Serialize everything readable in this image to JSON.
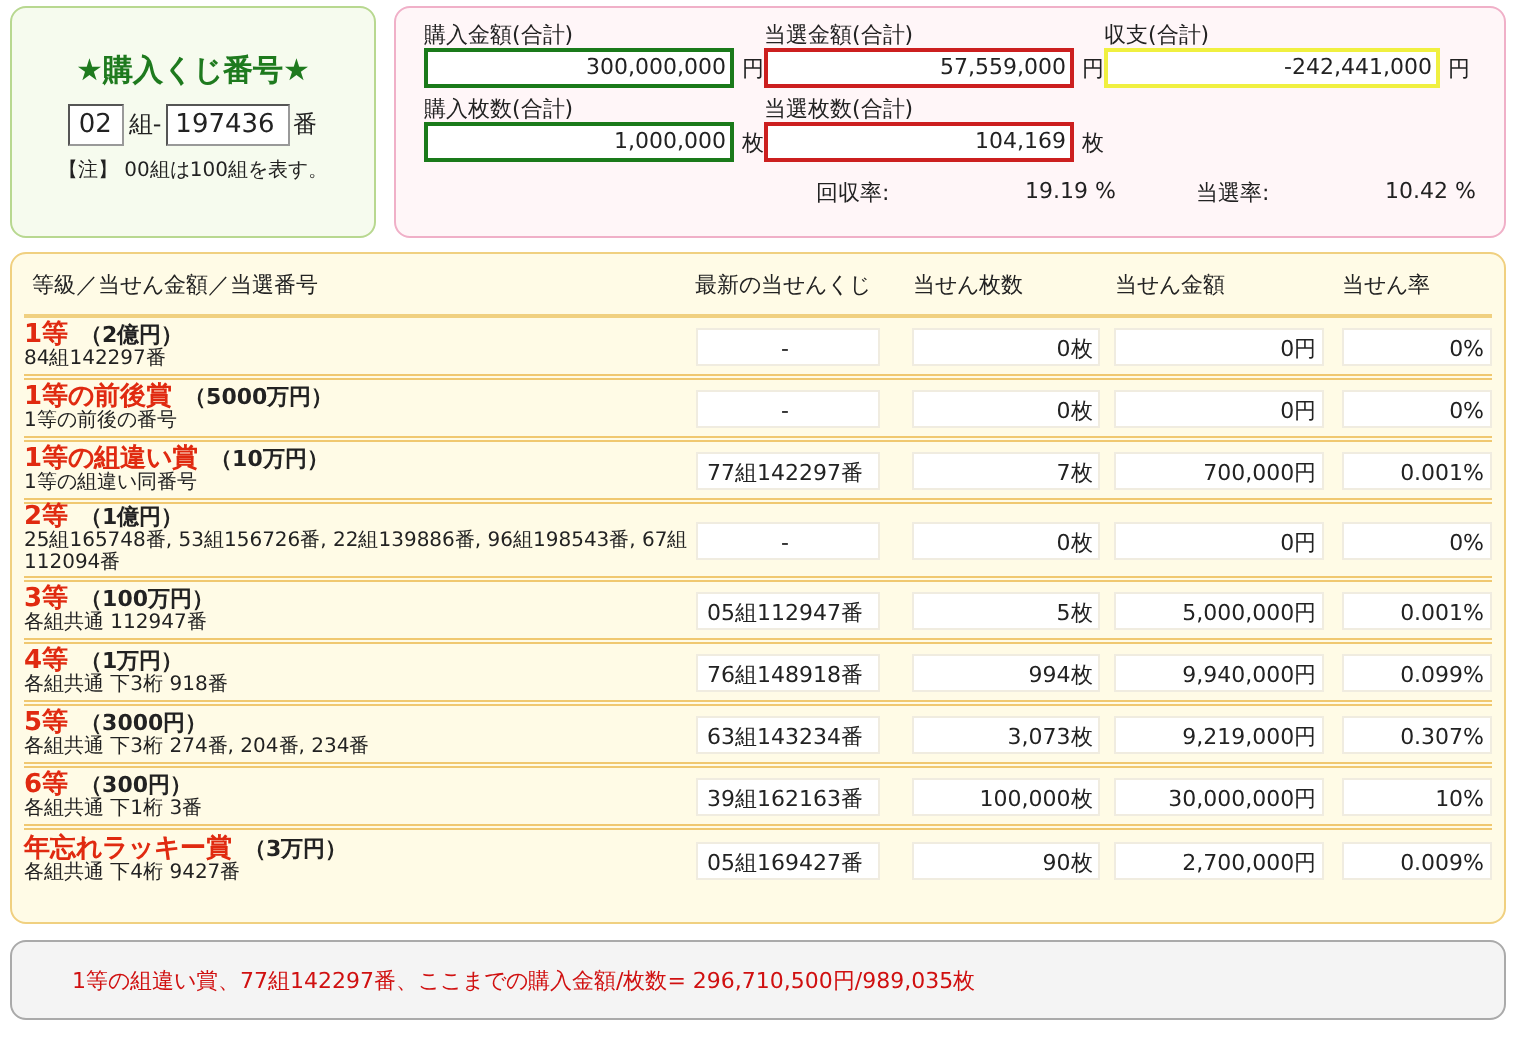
{
  "ticket": {
    "title": "★購入くじ番号★",
    "group": "02",
    "group_unit": "組-",
    "number": "197436",
    "number_unit": "番",
    "note": "【注】 00組は100組を表す。"
  },
  "totals": {
    "items": [
      {
        "label": "購入金額(合計)",
        "value": "300,000,000",
        "unit": "円",
        "color": "#1a7a1a"
      },
      {
        "label": "当選金額(合計)",
        "value": "57,559,000",
        "unit": "円",
        "color": "#cc1f1f"
      },
      {
        "label": "収支(合計)",
        "value": "-242,441,000",
        "unit": "円",
        "color": "#f0f040"
      },
      {
        "label": "購入枚数(合計)",
        "value": "1,000,000",
        "unit": "枚",
        "color": "#1a7a1a"
      },
      {
        "label": "当選枚数(合計)",
        "value": "104,169",
        "unit": "枚",
        "color": "#cc1f1f"
      }
    ],
    "ratios": [
      {
        "label": "回収率:",
        "value": "19.19 %"
      },
      {
        "label": "当選率:",
        "value": "10.42 %"
      }
    ]
  },
  "table": {
    "columns": [
      "等級／当せん金額／当選番号",
      "最新の当せんくじ",
      "当せん枚数",
      "当せん金額",
      "当せん率"
    ],
    "rows": [
      {
        "grade": "1等",
        "prize": "（2億円）",
        "numbers": "84組142297番",
        "latest": "-",
        "count": "0枚",
        "amount": "0円",
        "rate": "0%"
      },
      {
        "grade": "1等の前後賞",
        "prize": "（5000万円）",
        "numbers": "1等の前後の番号",
        "latest": "-",
        "count": "0枚",
        "amount": "0円",
        "rate": "0%"
      },
      {
        "grade": "1等の組違い賞",
        "prize": "（10万円）",
        "numbers": "1等の組違い同番号",
        "latest": "77組142297番",
        "count": "7枚",
        "amount": "700,000円",
        "rate": "0.001%"
      },
      {
        "grade": "2等",
        "prize": "（1億円）",
        "numbers": "25組165748番, 53組156726番, 22組139886番, 96組198543番, 67組112094番",
        "latest": "-",
        "count": "0枚",
        "amount": "0円",
        "rate": "0%"
      },
      {
        "grade": "3等",
        "prize": "（100万円）",
        "numbers": "各組共通 112947番",
        "latest": "05組112947番",
        "count": "5枚",
        "amount": "5,000,000円",
        "rate": "0.001%"
      },
      {
        "grade": "4等",
        "prize": "（1万円）",
        "numbers": "各組共通 下3桁 918番",
        "latest": "76組148918番",
        "count": "994枚",
        "amount": "9,940,000円",
        "rate": "0.099%"
      },
      {
        "grade": "5等",
        "prize": "（3000円）",
        "numbers": "各組共通 下3桁 274番, 204番, 234番",
        "latest": "63組143234番",
        "count": "3,073枚",
        "amount": "9,219,000円",
        "rate": "0.307%"
      },
      {
        "grade": "6等",
        "prize": "（300円）",
        "numbers": "各組共通 下1桁 3番",
        "latest": "39組162163番",
        "count": "100,000枚",
        "amount": "30,000,000円",
        "rate": "10%"
      },
      {
        "grade": "年忘れラッキー賞",
        "prize": "（3万円）",
        "numbers": "各組共通 下4桁 9427番",
        "latest": "05組169427番",
        "count": "90枚",
        "amount": "2,700,000円",
        "rate": "0.009%"
      }
    ]
  },
  "message": "1等の組違い賞、77組142297番、ここまでの購入金額/枚数= 296,710,500円/989,035枚"
}
